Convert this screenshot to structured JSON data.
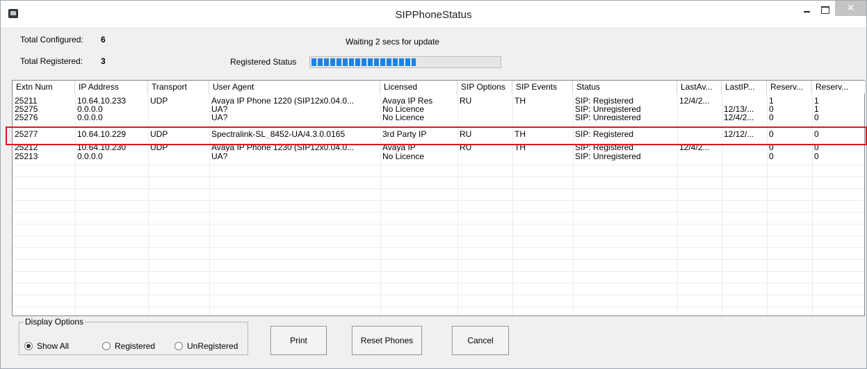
{
  "window": {
    "title": "SIPPhoneStatus",
    "close_glyph": "✕"
  },
  "summary": {
    "total_configured_label": "Total Configured:",
    "total_configured_value": "6",
    "total_registered_label": "Total Registered:",
    "total_registered_value": "3",
    "update_message": "Waiting 2 secs for update",
    "registered_status_label": "Registered Status",
    "registered_status_progress_percent": 55
  },
  "table": {
    "columns": [
      "Extn Num",
      "IP Address",
      "Transport",
      "User Agent",
      "Licensed",
      "SIP Options",
      "SIP Events",
      "Status",
      "LastAv...",
      "LastIP...",
      "Reserv...",
      "Reserv..."
    ],
    "rows": [
      [
        "25211",
        "10.64.10.233",
        "UDP",
        "Avaya IP Phone 1220 (SIP12x0.04.0...",
        "Avaya IP Res",
        "RU",
        "TH",
        "SIP: Registered",
        "12/4/2...",
        "",
        "1",
        "1"
      ],
      [
        "25275",
        "0.0.0.0",
        "",
        "UA?",
        "No Licence",
        "",
        "",
        "SIP: Unregistered",
        "",
        "12/13/...",
        "0",
        "1"
      ],
      [
        "25276",
        "0.0.0.0",
        "",
        "UA?",
        "No Licence",
        "",
        "",
        "SIP: Unregistered",
        "",
        "12/4/2...",
        "0",
        "0"
      ],
      [
        "25277",
        "10.64.10.229",
        "UDP",
        "Spectralink-SL_8452-UA/4.3.0.0165",
        "3rd Party IP",
        "RU",
        "TH",
        "SIP: Registered",
        "",
        "12/12/...",
        "0",
        "0"
      ],
      [
        "25212",
        "10.64.10.230",
        "UDP",
        "Avaya IP Phone 1230 (SIP12x0.04.0...",
        "Avaya IP",
        "RU",
        "TH",
        "SIP: Registered",
        "12/4/2...",
        "",
        "0",
        "0"
      ],
      [
        "25213",
        "0.0.0.0",
        "",
        "UA?",
        "No Licence",
        "",
        "",
        "SIP: Unregistered",
        "",
        "",
        "0",
        "0"
      ]
    ]
  },
  "display_options": {
    "legend": "Display Options",
    "options": [
      "Show All",
      "Registered",
      "UnRegistered"
    ],
    "selected": "Show All"
  },
  "buttons": {
    "print": "Print",
    "reset": "Reset Phones",
    "cancel": "Cancel"
  },
  "colors": {
    "highlight": "#e0141e",
    "progress": "#1c83e2"
  }
}
